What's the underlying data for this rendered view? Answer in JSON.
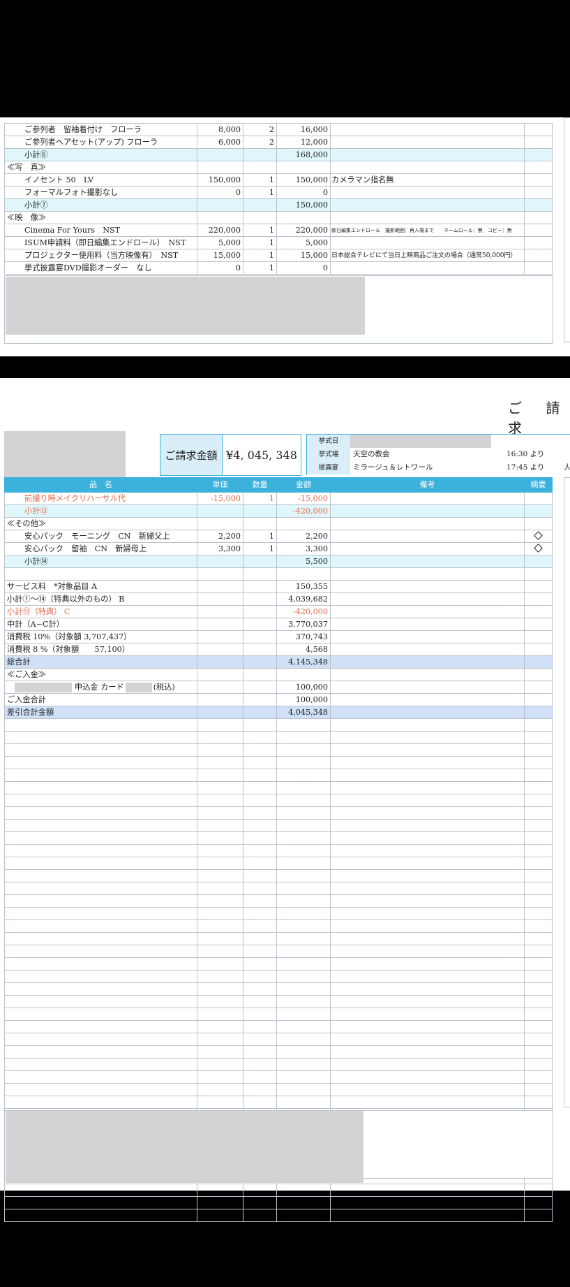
{
  "page1": {
    "rows": [
      {
        "kind": "item",
        "name": "ご参列者　留袖着付け　フローラ",
        "price": "8,000",
        "qty": "2",
        "amount": "16,000",
        "note": ""
      },
      {
        "kind": "item",
        "name": "ご参列者ヘアセット(アップ) フローラ",
        "price": "6,000",
        "qty": "2",
        "amount": "12,000",
        "note": ""
      },
      {
        "kind": "sub",
        "name": "小計⑥",
        "price": "",
        "qty": "",
        "amount": "168,000",
        "note": ""
      },
      {
        "kind": "section",
        "name": "≪写　真≫",
        "price": "",
        "qty": "",
        "amount": "",
        "note": ""
      },
      {
        "kind": "item",
        "name": "イノセント 50　LV",
        "price": "150,000",
        "qty": "1",
        "amount": "150,000",
        "note": "カメラマン指名無"
      },
      {
        "kind": "item",
        "name": "フォーマルフォト撮影なし",
        "price": "0",
        "qty": "1",
        "amount": "0",
        "note": ""
      },
      {
        "kind": "sub",
        "name": "小計⑦",
        "price": "",
        "qty": "",
        "amount": "150,000",
        "note": ""
      },
      {
        "kind": "section",
        "name": "≪映　像≫",
        "price": "",
        "qty": "",
        "amount": "",
        "note": ""
      },
      {
        "kind": "item",
        "name": "Cinema For Yours　NST",
        "price": "220,000",
        "qty": "1",
        "amount": "220,000",
        "note": "即日編集エンドロール　撮影範囲：再入場まで　　ネームロール：無　コピー：無",
        "noteSize": "tiny"
      },
      {
        "kind": "item",
        "name": "ISUM申請料（即日編集エンドロール）　NST",
        "price": "5,000",
        "qty": "1",
        "amount": "5,000",
        "note": ""
      },
      {
        "kind": "item",
        "name": "プロジェクター使用料（当方映像有）　NST",
        "price": "15,000",
        "qty": "1",
        "amount": "15,000",
        "note": "日本総合テレビにて当日上映商品ご注文の場合（通常50,000円）",
        "noteSize": "small"
      },
      {
        "kind": "item",
        "name": "挙式披露宴DVD撮影オーダー　なし",
        "price": "0",
        "qty": "1",
        "amount": "0",
        "note": ""
      }
    ]
  },
  "page2": {
    "title_chars": "ご 請 求",
    "amount_label": "ご請求金額",
    "amount_value": "¥4, 045, 348",
    "info": [
      {
        "label": "挙式日",
        "value": "",
        "time": ""
      },
      {
        "label": "挙式場",
        "value": "天空の教会",
        "time": "16:30 より"
      },
      {
        "label": "披露宴",
        "value": "ミラージュ＆レトワール",
        "time": "17:45 より",
        "extra": "人"
      }
    ],
    "headers": {
      "name": "品　名",
      "price": "単価",
      "qty": "数量",
      "amount": "金額",
      "note": "備考",
      "summary": "摘要"
    },
    "rows": [
      {
        "kind": "item",
        "style": "red",
        "name": "前撮り時メイクリハーサル代",
        "price": "-15,000",
        "qty": "1",
        "amount": "-15,000",
        "note": "",
        "mark": ""
      },
      {
        "kind": "sub",
        "style": "red",
        "name": "小計⑬",
        "price": "",
        "qty": "",
        "amount": "-420,000",
        "note": "",
        "mark": ""
      },
      {
        "kind": "section",
        "name": "≪その他≫",
        "price": "",
        "qty": "",
        "amount": "",
        "note": "",
        "mark": ""
      },
      {
        "kind": "item",
        "name": "安心パック　モーニング　CN　新婦父上",
        "price": "2,200",
        "qty": "1",
        "amount": "2,200",
        "note": "",
        "mark": "diamond"
      },
      {
        "kind": "item",
        "name": "安心パック　留袖　CN　新婦母上",
        "price": "3,300",
        "qty": "1",
        "amount": "3,300",
        "note": "",
        "mark": "diamond"
      },
      {
        "kind": "sub",
        "name": "小計⑭",
        "price": "",
        "qty": "",
        "amount": "5,500",
        "note": "",
        "mark": ""
      },
      {
        "kind": "blank"
      },
      {
        "kind": "plain",
        "name": "サービス料　*対象品目 A",
        "amount": "150,355"
      },
      {
        "kind": "plain",
        "name": "小計①～⑭（特典以外のもの） B",
        "amount": "4,039,682"
      },
      {
        "kind": "plain",
        "style": "red",
        "name": "小計⑬（特典） C",
        "amount": "-420,000"
      },
      {
        "kind": "plain",
        "name": "中計（A~C計）",
        "amount": "3,770,037"
      },
      {
        "kind": "plain",
        "name": "消費税 10%（対象額 3,707,437）",
        "amount": "370,743"
      },
      {
        "kind": "plain",
        "name": "消費税 8 %（対象額　　57,100）",
        "amount": "4,568"
      },
      {
        "kind": "total",
        "name": "総合計",
        "amount": "4,145,348"
      },
      {
        "kind": "section",
        "name": "≪ご入金≫",
        "amount": ""
      },
      {
        "kind": "payment",
        "name": "申込金 カード",
        "suffix": "(税込)",
        "amount": "100,000"
      },
      {
        "kind": "plain",
        "name": "ご入金合計",
        "amount": "100,000"
      },
      {
        "kind": "total",
        "name": "差引合計金額",
        "amount": "4,045,348"
      }
    ],
    "empty_rows": 40
  }
}
